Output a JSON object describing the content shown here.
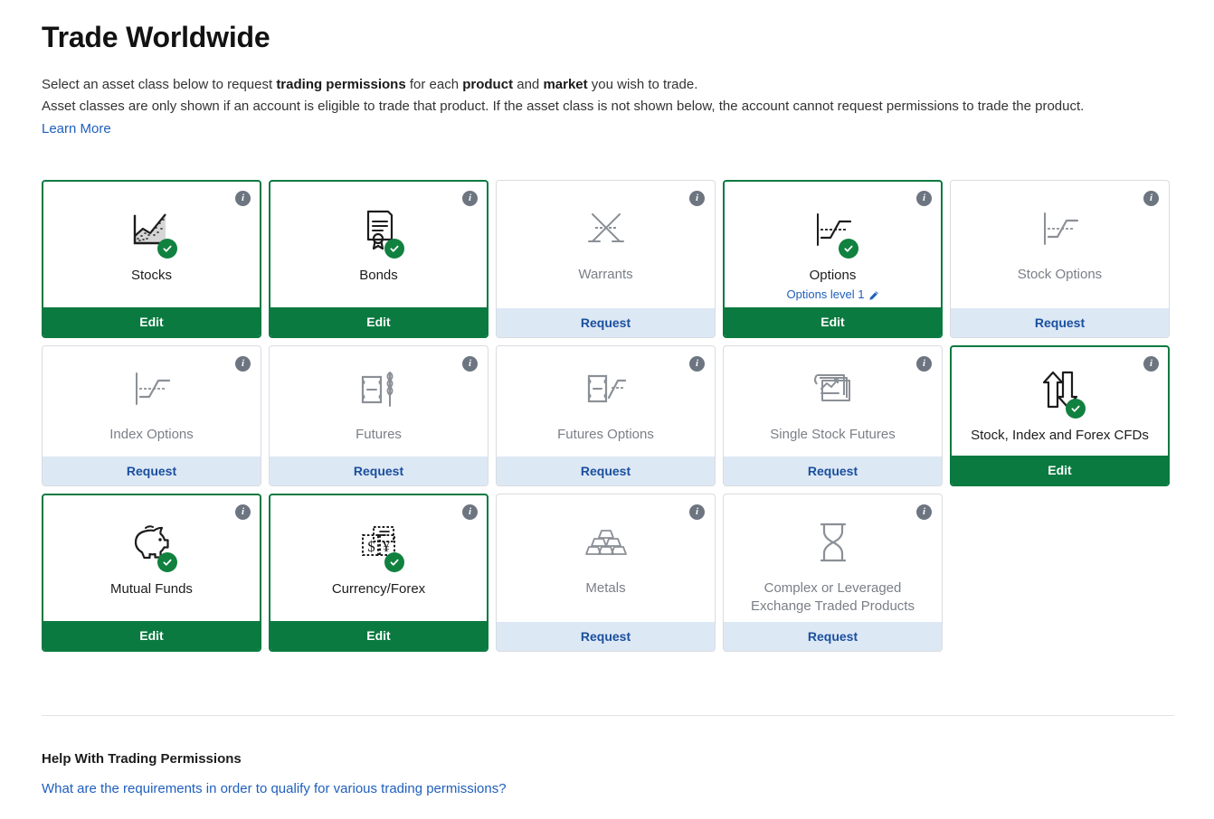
{
  "header": {
    "title": "Trade Worldwide",
    "intro_line1_parts": [
      {
        "text": "Select an asset class below to request ",
        "bold": false
      },
      {
        "text": "trading permissions",
        "bold": true
      },
      {
        "text": " for each ",
        "bold": false
      },
      {
        "text": "product",
        "bold": true
      },
      {
        "text": " and ",
        "bold": false
      },
      {
        "text": "market",
        "bold": true
      },
      {
        "text": " you wish to trade.",
        "bold": false
      }
    ],
    "intro_line2": "Asset classes are only shown if an account is eligible to trade that product. If the asset class is not shown below, the account cannot request permissions to trade the product.",
    "learn_more_label": "Learn More"
  },
  "colors": {
    "active_green": "#0a7a40",
    "check_green": "#118140",
    "request_bg": "#dde8f5",
    "request_text": "#1a4f9e",
    "link_blue": "#1f5fbd",
    "inactive_border": "#d9dce0",
    "inactive_text": "#7a7f86",
    "info_icon_bg": "#6d7581"
  },
  "labels": {
    "edit": "Edit",
    "request": "Request",
    "info_glyph": "i"
  },
  "rows": [
    {
      "height": "tall",
      "cards": [
        {
          "label": "Stocks",
          "icon": "stocks-chart-icon",
          "state": "active",
          "action": "Edit",
          "sub": null
        },
        {
          "label": "Bonds",
          "icon": "certificate-icon",
          "state": "active",
          "action": "Edit",
          "sub": null
        },
        {
          "label": "Warrants",
          "icon": "warrants-cross-icon",
          "state": "inactive",
          "action": "Request",
          "sub": null
        },
        {
          "label": "Options",
          "icon": "options-payoff-icon",
          "state": "active",
          "action": "Edit",
          "sub": "Options level 1"
        },
        {
          "label": "Stock Options",
          "icon": "options-payoff-icon",
          "state": "inactive",
          "action": "Request",
          "sub": null
        }
      ]
    },
    {
      "height": "mid",
      "cards": [
        {
          "label": "Index Options",
          "icon": "options-payoff-icon",
          "state": "inactive",
          "action": "Request",
          "sub": null
        },
        {
          "label": "Futures",
          "icon": "barrel-wheat-icon",
          "state": "inactive",
          "action": "Request",
          "sub": null
        },
        {
          "label": "Futures Options",
          "icon": "barrel-payoff-icon",
          "state": "inactive",
          "action": "Request",
          "sub": null
        },
        {
          "label": "Single Stock Futures",
          "icon": "stacked-charts-icon",
          "state": "inactive",
          "action": "Request",
          "sub": null
        },
        {
          "label": "Stock, Index and Forex CFDs",
          "icon": "arrows-updown-icon",
          "state": "active",
          "action": "Edit",
          "sub": null
        }
      ]
    },
    {
      "height": "tall",
      "cards": [
        {
          "label": "Mutual Funds",
          "icon": "piggy-bank-icon",
          "state": "active",
          "action": "Edit",
          "sub": null
        },
        {
          "label": "Currency/Forex",
          "icon": "banknotes-icon",
          "state": "active",
          "action": "Edit",
          "sub": null
        },
        {
          "label": "Metals",
          "icon": "gold-bars-icon",
          "state": "inactive",
          "action": "Request",
          "sub": null
        },
        {
          "label": "Complex or Leveraged Exchange Traded Products",
          "icon": "hourglass-icon",
          "state": "inactive",
          "action": "Request",
          "sub": null
        }
      ]
    }
  ],
  "footer": {
    "help_title": "Help With Trading Permissions",
    "help_link": "What are the requirements in order to qualify for various trading permissions?"
  }
}
